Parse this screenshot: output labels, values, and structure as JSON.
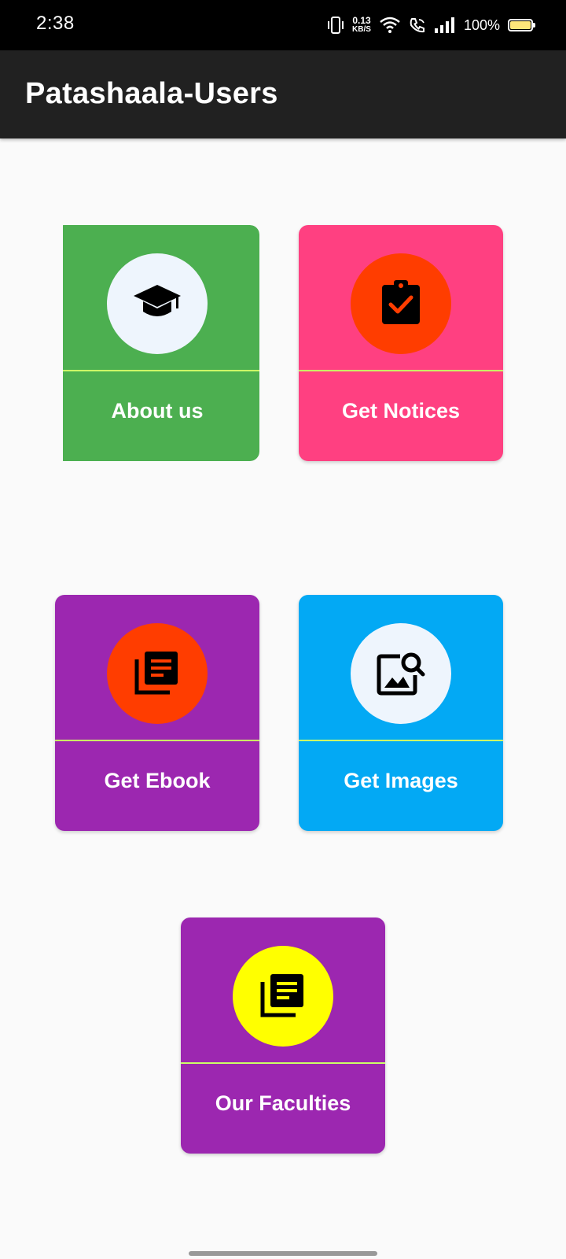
{
  "status_bar": {
    "time": "2:38",
    "net_speed_value": "0.13",
    "net_speed_unit": "KB/S",
    "battery_percent": "100%",
    "icons": [
      "vibrate-icon",
      "wifi-icon",
      "wifi-calling-icon",
      "signal-icon",
      "battery-icon"
    ]
  },
  "app_bar": {
    "title": "Patashaala-Users"
  },
  "cards": [
    {
      "label": "About us",
      "icon": "graduation-cap-icon",
      "card_color": "#4caf50",
      "circle_color": "#eef5fd"
    },
    {
      "label": "Get Notices",
      "icon": "clipboard-check-icon",
      "card_color": "#ff4081",
      "circle_color": "#ff3d00"
    },
    {
      "label": "Get Ebook",
      "icon": "library-books-icon",
      "card_color": "#9c27b0",
      "circle_color": "#ff3d00"
    },
    {
      "label": "Get Images",
      "icon": "image-search-icon",
      "card_color": "#03a9f4",
      "circle_color": "#eef5fd"
    },
    {
      "label": "Our Faculties",
      "icon": "library-books-icon",
      "card_color": "#9c27b0",
      "circle_color": "#ffff00"
    }
  ],
  "colors": {
    "divider": "#ccff66",
    "app_bar": "#212121",
    "background": "#fafafa"
  }
}
